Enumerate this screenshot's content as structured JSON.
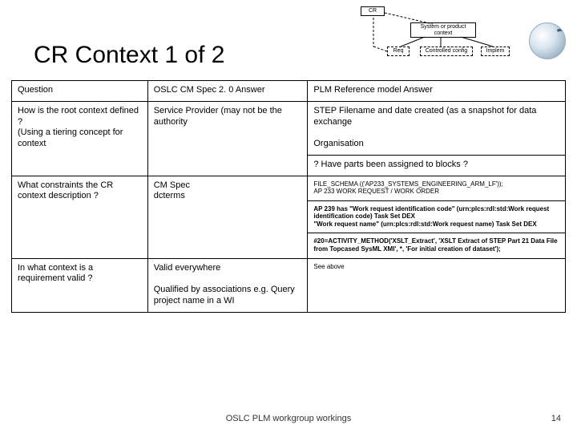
{
  "title": "CR Context 1 of 2",
  "diagram": {
    "cr": "CR",
    "sys": "System or product context",
    "req": "Req",
    "ctrl": "Controlled config",
    "impl": "Implem"
  },
  "headers": {
    "q": "Question",
    "a": "OSLC CM Spec 2. 0 Answer",
    "p": "PLM Reference model Answer"
  },
  "r1": {
    "q1": "How is the root context defined ?",
    "q2": "(Using a tiering concept for context",
    "a": "Service Provider (may not be the authority",
    "p1": "STEP Filename and date created (as a snapshot for data exchange",
    "p2": "Organisation"
  },
  "r1b": {
    "p": "? Have parts been assigned to blocks ?"
  },
  "r2": {
    "q": "What constraints the CR context description ?",
    "a1": "CM Spec",
    "a2": "dcterms",
    "p1": "FILE_SCHEMA (('AP233_SYSTEMS_ENGINEERING_ARM_LF'));",
    "p2": "AP 233 WORK REQUEST / WORK ORDER"
  },
  "r2b": {
    "l1": "AP 239 has \"Work request identification code\" (urn:plcs:rdl:std:Work request identification code)       Task Set DEX",
    "l2": "\"Work request name\" (urn:plcs:rdl:std:Work request name)            Task Set DEX"
  },
  "r2c": {
    "p": "#20=ACTIVITY_METHOD('XSLT_Extract', 'XSLT Extract of STEP Part 21 Data File from Topcased SysML XMI', *, 'For initial creation of dataset');"
  },
  "r3": {
    "q": "In what context is a requirement valid ?",
    "a1": "Valid everywhere",
    "a2": "Qualified by associations e.g. Query project name in a WI",
    "p": "See above"
  },
  "footer": {
    "left": "OSLC PLM workgroup workings",
    "right": "14"
  }
}
